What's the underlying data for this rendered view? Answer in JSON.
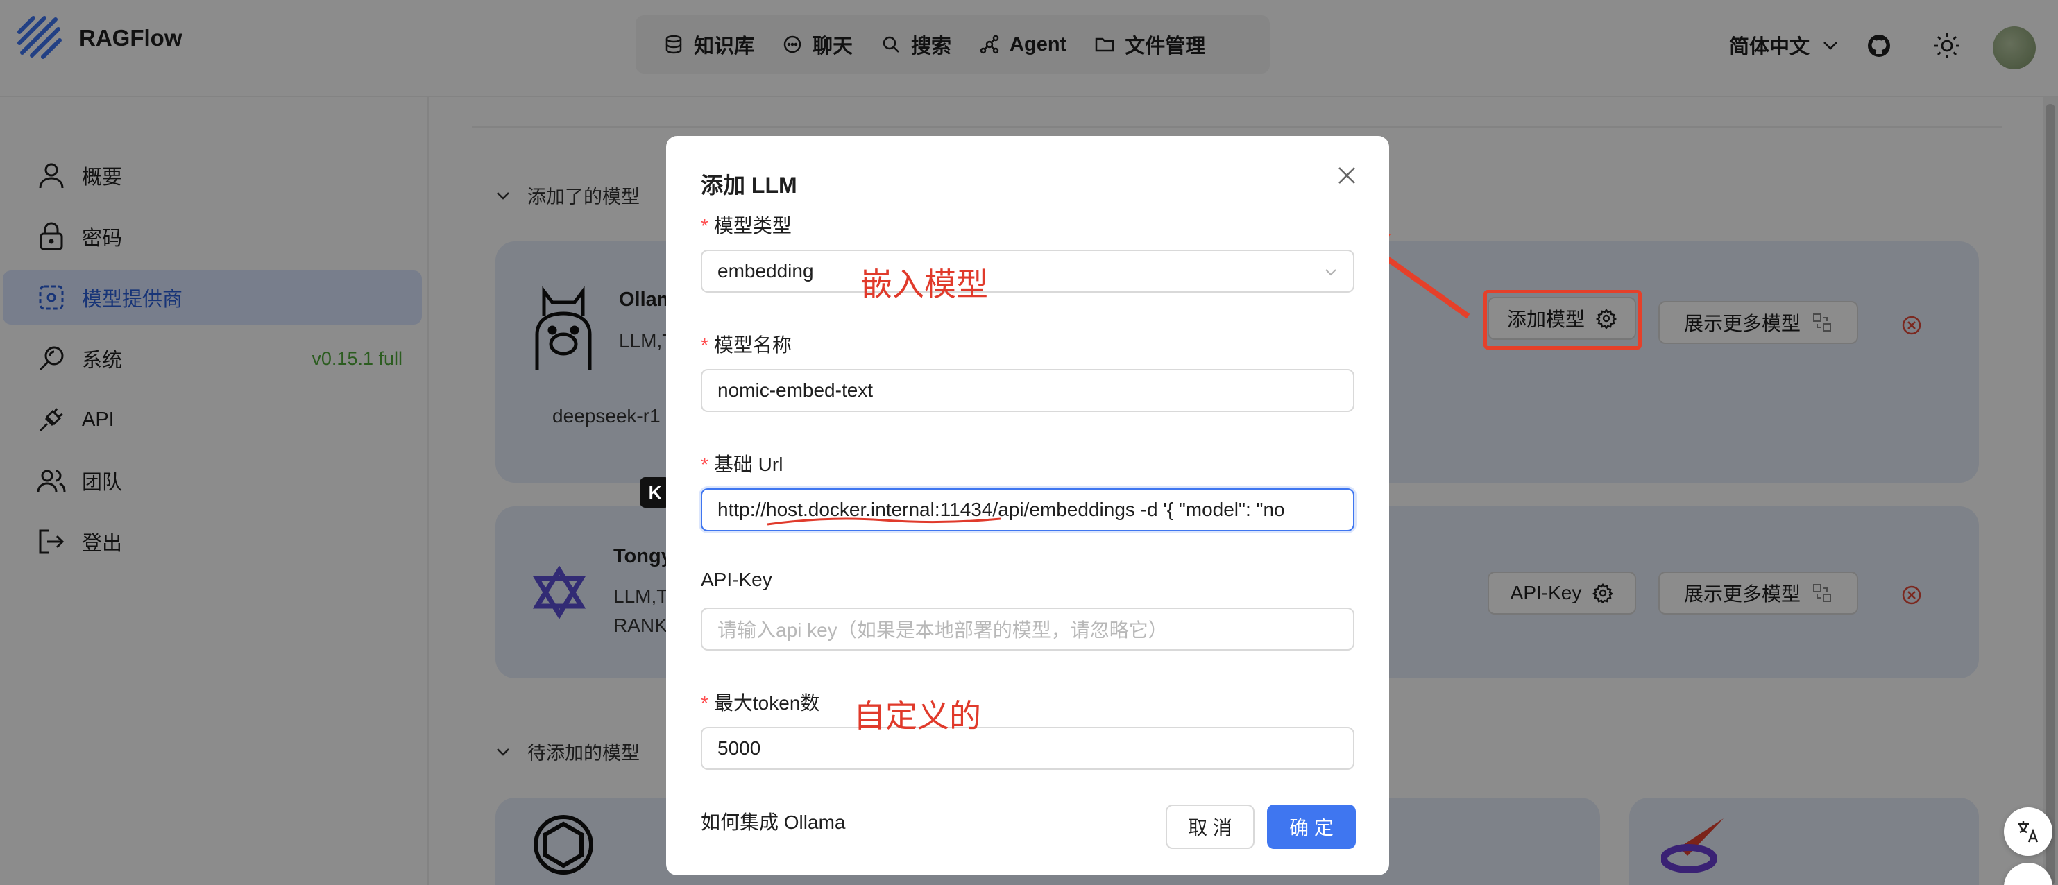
{
  "app": {
    "name": "RAGFlow"
  },
  "nav": {
    "items": [
      {
        "label": "知识库",
        "icon": "database-icon"
      },
      {
        "label": "聊天",
        "icon": "chat-icon"
      },
      {
        "label": "搜索",
        "icon": "search-icon"
      },
      {
        "label": "Agent",
        "icon": "agent-icon"
      },
      {
        "label": "文件管理",
        "icon": "folder-icon"
      }
    ]
  },
  "header": {
    "language": "简体中文"
  },
  "sidebar": {
    "items": [
      {
        "label": "概要",
        "icon": "user-icon"
      },
      {
        "label": "密码",
        "icon": "lock-icon"
      },
      {
        "label": "模型提供商",
        "icon": "model-provider-icon",
        "active": true
      },
      {
        "label": "系统",
        "icon": "system-icon",
        "badge": "v0.15.1 full"
      },
      {
        "label": "API",
        "icon": "plug-icon"
      },
      {
        "label": "团队",
        "icon": "team-icon"
      },
      {
        "label": "登出",
        "icon": "logout-icon"
      }
    ]
  },
  "main": {
    "added_section": "添加了的模型",
    "pending_section": "待添加的模型",
    "providers": [
      {
        "name": "Ollam",
        "tags": "LLM,T",
        "models": "deepseek-r1",
        "action": "添加模型",
        "more": "展示更多模型"
      },
      {
        "name": "Tongy",
        "tags_line1": "LLM,T",
        "tags_line2": "RANK",
        "action": "API-Key",
        "more": "展示更多模型"
      }
    ]
  },
  "modal": {
    "title": "添加 LLM",
    "model_type_label": "模型类型",
    "model_type_value": "embedding",
    "model_name_label": "模型名称",
    "model_name_value": "nomic-embed-text",
    "base_url_label": "基础 Url",
    "base_url_value": "http://host.docker.internal:11434/api/embeddings -d '{   \"model\": \"no",
    "api_key_label": "API-Key",
    "api_key_placeholder": "请输入api key（如果是本地部署的模型，请忽略它）",
    "max_token_label": "最大token数",
    "max_token_value": "5000",
    "integration_link": "如何集成 Ollama",
    "cancel": "取 消",
    "ok": "确 定"
  },
  "annotations": {
    "embed_model": "嵌入模型",
    "custom": "自定义的"
  },
  "colors": {
    "accent": "#3f76f0",
    "annotation": "#e03a2b",
    "required": "#ff4d4f",
    "version": "#4fa83a"
  }
}
